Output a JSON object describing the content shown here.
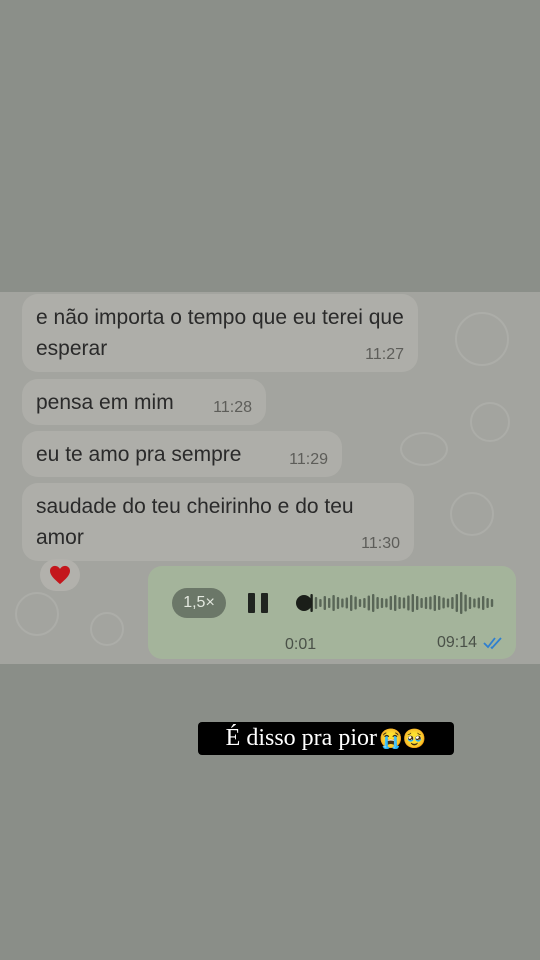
{
  "messages": [
    {
      "text": "e não importa o tempo que eu terei que esperar",
      "time": "11:27"
    },
    {
      "text": "pensa em mim",
      "time": "11:28"
    },
    {
      "text": "eu te amo pra sempre",
      "time": "11:29"
    },
    {
      "text": "saudade do teu cheirinho e do teu amor",
      "time": "11:30"
    }
  ],
  "reaction": {
    "emoji": "❤️",
    "icon": "heart-icon",
    "color": "#c4161c"
  },
  "voice_message": {
    "speed_label": "1,5×",
    "elapsed": "0:01",
    "time": "09:14",
    "status_icon": "double-check-icon",
    "status_color": "#2f7fd0",
    "play_icon": "pause-icon",
    "progress": 0.03
  },
  "story_caption": {
    "text": "É disso pra pior",
    "emojis": "😭🥹"
  }
}
